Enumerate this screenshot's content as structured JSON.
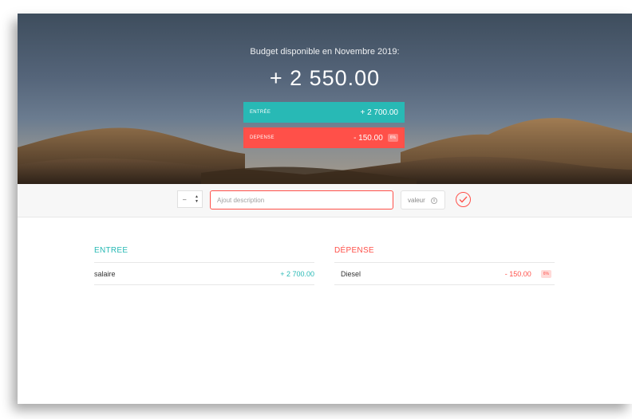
{
  "header": {
    "title": "Budget disponible en Novembre 2019:",
    "value": "+ 2 550.00",
    "income": {
      "label": "ENTRÉE",
      "value": "+ 2 700.00"
    },
    "expense": {
      "label": "DEPENSE",
      "value": "- 150.00",
      "percentage": "6%"
    }
  },
  "add_bar": {
    "type_value": "–",
    "description_placeholder": "Ajout description",
    "value_placeholder": "valeur",
    "accent": "#ff5049"
  },
  "lists": {
    "income": {
      "title": "ENTREE",
      "items": [
        {
          "description": "salaire",
          "value": "+ 2 700.00"
        }
      ]
    },
    "expense": {
      "title": "DÉPENSE",
      "items": [
        {
          "description": "Diesel",
          "value": "- 150.00",
          "percentage": "6%"
        }
      ]
    }
  },
  "colors": {
    "income": "#28b9b5",
    "expense": "#ff5049"
  },
  "icons": {
    "submit": "check-circle-icon",
    "spinner": "spinner-arrows-icon"
  }
}
